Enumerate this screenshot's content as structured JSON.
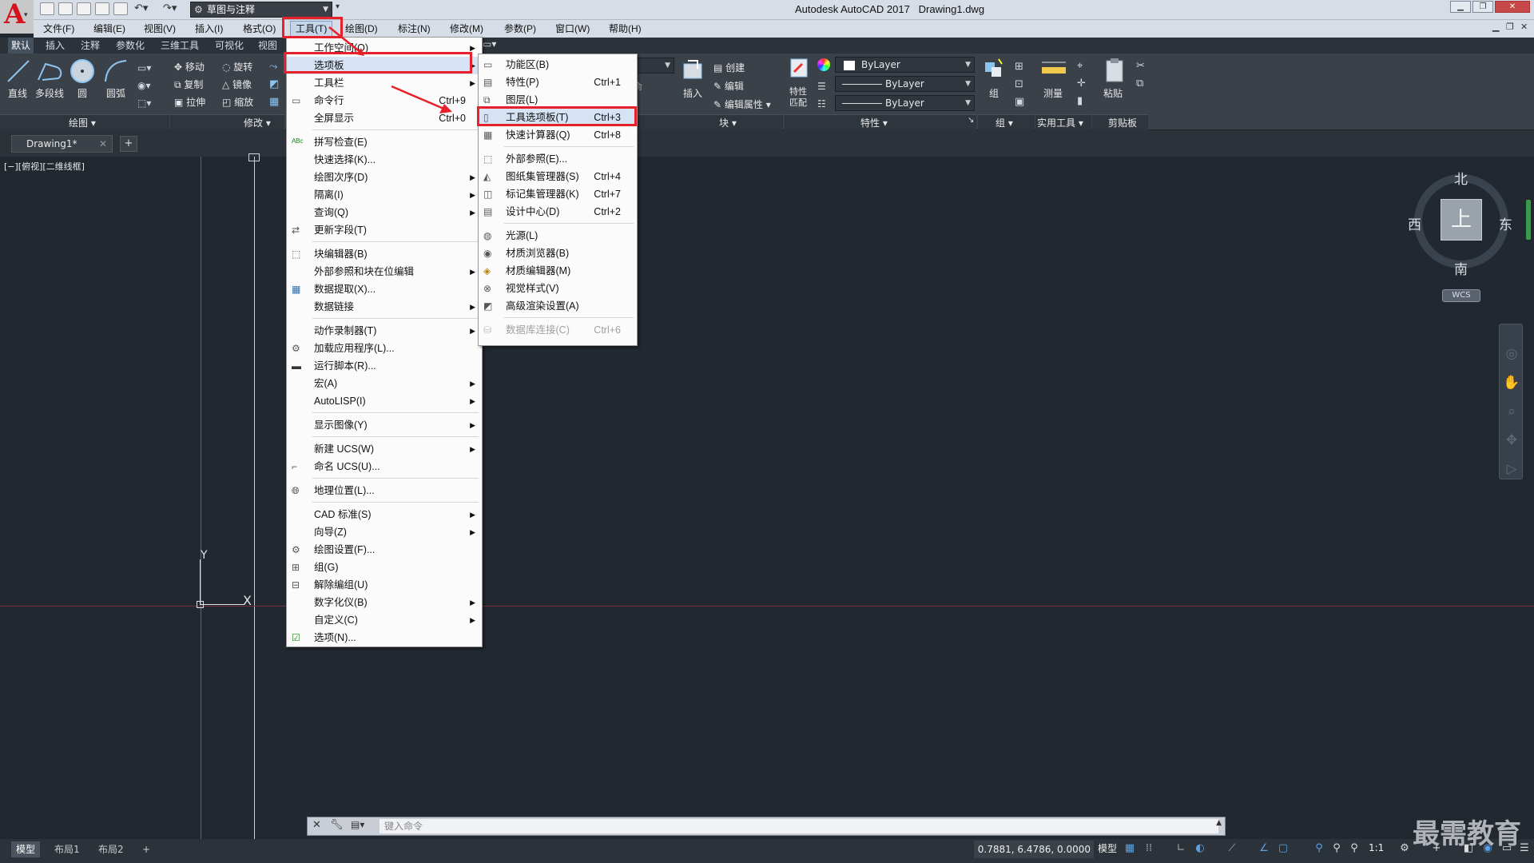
{
  "titlebar": {
    "app_title": "Autodesk AutoCAD 2017",
    "doc_name": "Drawing1.dwg",
    "workspace": "草图与注释"
  },
  "menubar": [
    "文件(F)",
    "编辑(E)",
    "视图(V)",
    "插入(I)",
    "格式(O)",
    "工具(T)",
    "绘图(D)",
    "标注(N)",
    "修改(M)",
    "参数(P)",
    "窗口(W)",
    "帮助(H)"
  ],
  "ribbon_tabs": [
    "默认",
    "插入",
    "注释",
    "参数化",
    "三维工具",
    "可视化",
    "视图"
  ],
  "ribbon": {
    "draw": {
      "line": "直线",
      "polyline": "多段线",
      "circle": "圆",
      "arc": "圆弧",
      "panel": "绘图"
    },
    "modify": {
      "move": "移动",
      "rotate": "旋转",
      "copy": "复制",
      "mirror": "镜像",
      "stretch": "拉伸",
      "scale": "缩放",
      "panel": "修改"
    },
    "block": {
      "insert": "插入",
      "create": "创建",
      "edit": "编辑",
      "edit_attr": "编辑属性",
      "panel": "块"
    },
    "properties": {
      "match": "特性匹配",
      "layer1": "ByLayer",
      "layer2": "ByLayer",
      "layer3": "ByLayer",
      "panel": "特性"
    },
    "groups": {
      "group": "组",
      "panel": "组"
    },
    "utilities": {
      "measure": "测量",
      "panel": "实用工具"
    },
    "clipboard": {
      "paste": "粘贴",
      "panel": "剪贴板"
    }
  },
  "file_tab": "Drawing1*",
  "viewport_label": "[−][俯视][二维线框]",
  "tools_menu": {
    "items": [
      {
        "label": "工作空间(O)",
        "shortcut": "",
        "sub": true
      },
      {
        "label": "选项板",
        "shortcut": "",
        "sub": true
      },
      {
        "label": "工具栏",
        "shortcut": "",
        "sub": true
      },
      {
        "label": "命令行",
        "shortcut": "Ctrl+9",
        "sub": false
      },
      {
        "label": "全屏显示",
        "shortcut": "Ctrl+0",
        "sub": false
      },
      {
        "label": "拼写检查(E)",
        "shortcut": "",
        "sub": false
      },
      {
        "label": "快速选择(K)...",
        "shortcut": "",
        "sub": false
      },
      {
        "label": "绘图次序(D)",
        "shortcut": "",
        "sub": true
      },
      {
        "label": "隔离(I)",
        "shortcut": "",
        "sub": true
      },
      {
        "label": "查询(Q)",
        "shortcut": "",
        "sub": true
      },
      {
        "label": "更新字段(T)",
        "shortcut": "",
        "sub": false
      },
      {
        "label": "块编辑器(B)",
        "shortcut": "",
        "sub": false
      },
      {
        "label": "外部参照和块在位编辑",
        "shortcut": "",
        "sub": true
      },
      {
        "label": "数据提取(X)...",
        "shortcut": "",
        "sub": false
      },
      {
        "label": "数据链接",
        "shortcut": "",
        "sub": true
      },
      {
        "label": "动作录制器(T)",
        "shortcut": "",
        "sub": true
      },
      {
        "label": "加载应用程序(L)...",
        "shortcut": "",
        "sub": false
      },
      {
        "label": "运行脚本(R)...",
        "shortcut": "",
        "sub": false
      },
      {
        "label": "宏(A)",
        "shortcut": "",
        "sub": true
      },
      {
        "label": "AutoLISP(I)",
        "shortcut": "",
        "sub": true
      },
      {
        "label": "显示图像(Y)",
        "shortcut": "",
        "sub": true
      },
      {
        "label": "新建 UCS(W)",
        "shortcut": "",
        "sub": true
      },
      {
        "label": "命名 UCS(U)...",
        "shortcut": "",
        "sub": false
      },
      {
        "label": "地理位置(L)...",
        "shortcut": "",
        "sub": false
      },
      {
        "label": "CAD 标准(S)",
        "shortcut": "",
        "sub": true
      },
      {
        "label": "向导(Z)",
        "shortcut": "",
        "sub": true
      },
      {
        "label": "绘图设置(F)...",
        "shortcut": "",
        "sub": false
      },
      {
        "label": "组(G)",
        "shortcut": "",
        "sub": false
      },
      {
        "label": "解除编组(U)",
        "shortcut": "",
        "sub": false
      },
      {
        "label": "数字化仪(B)",
        "shortcut": "",
        "sub": true
      },
      {
        "label": "自定义(C)",
        "shortcut": "",
        "sub": true
      },
      {
        "label": "选项(N)...",
        "shortcut": "",
        "sub": false
      }
    ]
  },
  "palettes_menu": {
    "items": [
      {
        "label": "功能区(B)",
        "shortcut": ""
      },
      {
        "label": "特性(P)",
        "shortcut": "Ctrl+1"
      },
      {
        "label": "图层(L)",
        "shortcut": ""
      },
      {
        "label": "工具选项板(T)",
        "shortcut": "Ctrl+3"
      },
      {
        "label": "快速计算器(Q)",
        "shortcut": "Ctrl+8"
      },
      {
        "label": "外部参照(E)...",
        "shortcut": ""
      },
      {
        "label": "图纸集管理器(S)",
        "shortcut": "Ctrl+4"
      },
      {
        "label": "标记集管理器(K)",
        "shortcut": "Ctrl+7"
      },
      {
        "label": "设计中心(D)",
        "shortcut": "Ctrl+2"
      },
      {
        "label": "光源(L)",
        "shortcut": ""
      },
      {
        "label": "材质浏览器(B)",
        "shortcut": ""
      },
      {
        "label": "材质编辑器(M)",
        "shortcut": ""
      },
      {
        "label": "视觉样式(V)",
        "shortcut": ""
      },
      {
        "label": "高级渲染设置(A)",
        "shortcut": ""
      },
      {
        "label": "数据库连接(C)",
        "shortcut": "Ctrl+6"
      }
    ]
  },
  "viewcube": {
    "north": "北",
    "south": "南",
    "east": "东",
    "west": "西",
    "top": "上",
    "wcs": "WCS"
  },
  "ucs": {
    "y": "Y",
    "x": "X"
  },
  "command": {
    "placeholder": "键入命令"
  },
  "status": {
    "layout_tabs": [
      "模型",
      "布局1",
      "布局2"
    ],
    "coords": "0.7881, 6.4786, 0.0000",
    "model": "模型",
    "scale": "1:1"
  },
  "watermark": "最需教育",
  "colors": {
    "highlight_red": "#e8202a",
    "canvas": "#212830",
    "menu_hover": "#d5e3f5"
  }
}
